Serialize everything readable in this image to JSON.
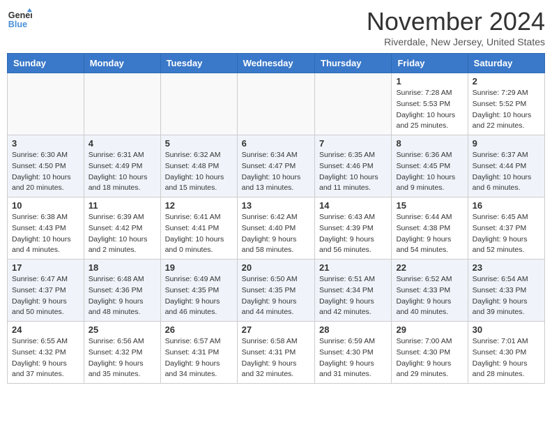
{
  "logo": {
    "line1": "General",
    "line2": "Blue"
  },
  "title": "November 2024",
  "location": "Riverdale, New Jersey, United States",
  "weekdays": [
    "Sunday",
    "Monday",
    "Tuesday",
    "Wednesday",
    "Thursday",
    "Friday",
    "Saturday"
  ],
  "weeks": [
    [
      {
        "day": "",
        "sunrise": "",
        "sunset": "",
        "daylight": ""
      },
      {
        "day": "",
        "sunrise": "",
        "sunset": "",
        "daylight": ""
      },
      {
        "day": "",
        "sunrise": "",
        "sunset": "",
        "daylight": ""
      },
      {
        "day": "",
        "sunrise": "",
        "sunset": "",
        "daylight": ""
      },
      {
        "day": "",
        "sunrise": "",
        "sunset": "",
        "daylight": ""
      },
      {
        "day": "1",
        "sunrise": "Sunrise: 7:28 AM",
        "sunset": "Sunset: 5:53 PM",
        "daylight": "Daylight: 10 hours and 25 minutes."
      },
      {
        "day": "2",
        "sunrise": "Sunrise: 7:29 AM",
        "sunset": "Sunset: 5:52 PM",
        "daylight": "Daylight: 10 hours and 22 minutes."
      }
    ],
    [
      {
        "day": "3",
        "sunrise": "Sunrise: 6:30 AM",
        "sunset": "Sunset: 4:50 PM",
        "daylight": "Daylight: 10 hours and 20 minutes."
      },
      {
        "day": "4",
        "sunrise": "Sunrise: 6:31 AM",
        "sunset": "Sunset: 4:49 PM",
        "daylight": "Daylight: 10 hours and 18 minutes."
      },
      {
        "day": "5",
        "sunrise": "Sunrise: 6:32 AM",
        "sunset": "Sunset: 4:48 PM",
        "daylight": "Daylight: 10 hours and 15 minutes."
      },
      {
        "day": "6",
        "sunrise": "Sunrise: 6:34 AM",
        "sunset": "Sunset: 4:47 PM",
        "daylight": "Daylight: 10 hours and 13 minutes."
      },
      {
        "day": "7",
        "sunrise": "Sunrise: 6:35 AM",
        "sunset": "Sunset: 4:46 PM",
        "daylight": "Daylight: 10 hours and 11 minutes."
      },
      {
        "day": "8",
        "sunrise": "Sunrise: 6:36 AM",
        "sunset": "Sunset: 4:45 PM",
        "daylight": "Daylight: 10 hours and 9 minutes."
      },
      {
        "day": "9",
        "sunrise": "Sunrise: 6:37 AM",
        "sunset": "Sunset: 4:44 PM",
        "daylight": "Daylight: 10 hours and 6 minutes."
      }
    ],
    [
      {
        "day": "10",
        "sunrise": "Sunrise: 6:38 AM",
        "sunset": "Sunset: 4:43 PM",
        "daylight": "Daylight: 10 hours and 4 minutes."
      },
      {
        "day": "11",
        "sunrise": "Sunrise: 6:39 AM",
        "sunset": "Sunset: 4:42 PM",
        "daylight": "Daylight: 10 hours and 2 minutes."
      },
      {
        "day": "12",
        "sunrise": "Sunrise: 6:41 AM",
        "sunset": "Sunset: 4:41 PM",
        "daylight": "Daylight: 10 hours and 0 minutes."
      },
      {
        "day": "13",
        "sunrise": "Sunrise: 6:42 AM",
        "sunset": "Sunset: 4:40 PM",
        "daylight": "Daylight: 9 hours and 58 minutes."
      },
      {
        "day": "14",
        "sunrise": "Sunrise: 6:43 AM",
        "sunset": "Sunset: 4:39 PM",
        "daylight": "Daylight: 9 hours and 56 minutes."
      },
      {
        "day": "15",
        "sunrise": "Sunrise: 6:44 AM",
        "sunset": "Sunset: 4:38 PM",
        "daylight": "Daylight: 9 hours and 54 minutes."
      },
      {
        "day": "16",
        "sunrise": "Sunrise: 6:45 AM",
        "sunset": "Sunset: 4:37 PM",
        "daylight": "Daylight: 9 hours and 52 minutes."
      }
    ],
    [
      {
        "day": "17",
        "sunrise": "Sunrise: 6:47 AM",
        "sunset": "Sunset: 4:37 PM",
        "daylight": "Daylight: 9 hours and 50 minutes."
      },
      {
        "day": "18",
        "sunrise": "Sunrise: 6:48 AM",
        "sunset": "Sunset: 4:36 PM",
        "daylight": "Daylight: 9 hours and 48 minutes."
      },
      {
        "day": "19",
        "sunrise": "Sunrise: 6:49 AM",
        "sunset": "Sunset: 4:35 PM",
        "daylight": "Daylight: 9 hours and 46 minutes."
      },
      {
        "day": "20",
        "sunrise": "Sunrise: 6:50 AM",
        "sunset": "Sunset: 4:35 PM",
        "daylight": "Daylight: 9 hours and 44 minutes."
      },
      {
        "day": "21",
        "sunrise": "Sunrise: 6:51 AM",
        "sunset": "Sunset: 4:34 PM",
        "daylight": "Daylight: 9 hours and 42 minutes."
      },
      {
        "day": "22",
        "sunrise": "Sunrise: 6:52 AM",
        "sunset": "Sunset: 4:33 PM",
        "daylight": "Daylight: 9 hours and 40 minutes."
      },
      {
        "day": "23",
        "sunrise": "Sunrise: 6:54 AM",
        "sunset": "Sunset: 4:33 PM",
        "daylight": "Daylight: 9 hours and 39 minutes."
      }
    ],
    [
      {
        "day": "24",
        "sunrise": "Sunrise: 6:55 AM",
        "sunset": "Sunset: 4:32 PM",
        "daylight": "Daylight: 9 hours and 37 minutes."
      },
      {
        "day": "25",
        "sunrise": "Sunrise: 6:56 AM",
        "sunset": "Sunset: 4:32 PM",
        "daylight": "Daylight: 9 hours and 35 minutes."
      },
      {
        "day": "26",
        "sunrise": "Sunrise: 6:57 AM",
        "sunset": "Sunset: 4:31 PM",
        "daylight": "Daylight: 9 hours and 34 minutes."
      },
      {
        "day": "27",
        "sunrise": "Sunrise: 6:58 AM",
        "sunset": "Sunset: 4:31 PM",
        "daylight": "Daylight: 9 hours and 32 minutes."
      },
      {
        "day": "28",
        "sunrise": "Sunrise: 6:59 AM",
        "sunset": "Sunset: 4:30 PM",
        "daylight": "Daylight: 9 hours and 31 minutes."
      },
      {
        "day": "29",
        "sunrise": "Sunrise: 7:00 AM",
        "sunset": "Sunset: 4:30 PM",
        "daylight": "Daylight: 9 hours and 29 minutes."
      },
      {
        "day": "30",
        "sunrise": "Sunrise: 7:01 AM",
        "sunset": "Sunset: 4:30 PM",
        "daylight": "Daylight: 9 hours and 28 minutes."
      }
    ]
  ]
}
